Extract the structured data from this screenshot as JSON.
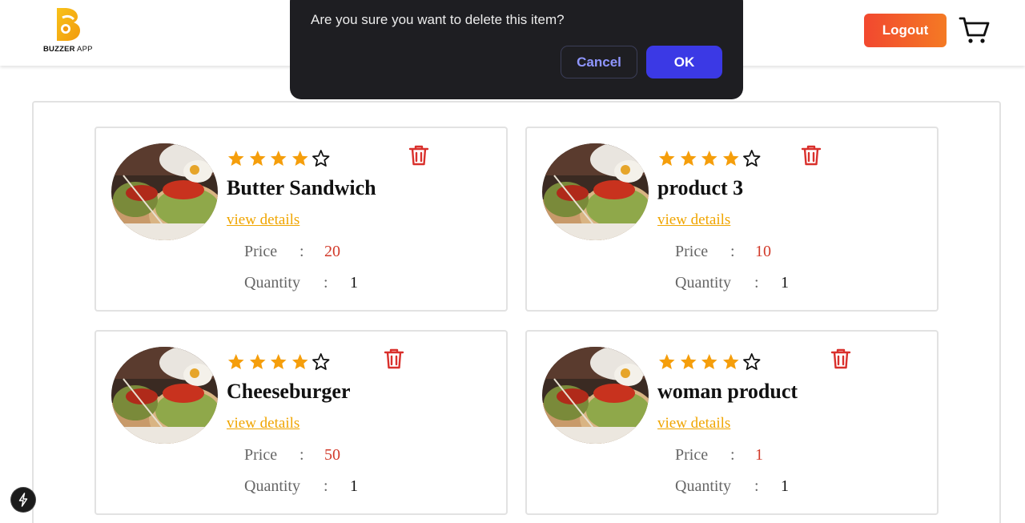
{
  "header": {
    "logo_bold": "BUZZER",
    "logo_light": " APP",
    "logout_label": "Logout",
    "cart_icon": "shopping-cart-icon"
  },
  "dialog": {
    "message": "Are you sure you want to delete this item?",
    "cancel_label": "Cancel",
    "ok_label": "OK"
  },
  "labels": {
    "price": "Price",
    "quantity": "Quantity",
    "colon": ":",
    "view_details": "view details"
  },
  "products": [
    {
      "name": "Butter Sandwich",
      "rating": 4,
      "rating_max": 5,
      "price": "20",
      "quantity": "1"
    },
    {
      "name": "product 3",
      "rating": 4,
      "rating_max": 5,
      "price": "10",
      "quantity": "1"
    },
    {
      "name": "Cheeseburger",
      "rating": 4,
      "rating_max": 5,
      "price": "50",
      "quantity": "1"
    },
    {
      "name": "woman product",
      "rating": 4,
      "rating_max": 5,
      "price": "1",
      "quantity": "1"
    }
  ],
  "colors": {
    "accent": "#f0a500",
    "price": "#d23a2a",
    "trash": "#d9302c",
    "star_filled": "#f59e0b",
    "logout_start": "#f2482f",
    "logout_end": "#f47a24",
    "dialog_bg": "#1e1e22",
    "ok_bg": "#3b39e5"
  }
}
